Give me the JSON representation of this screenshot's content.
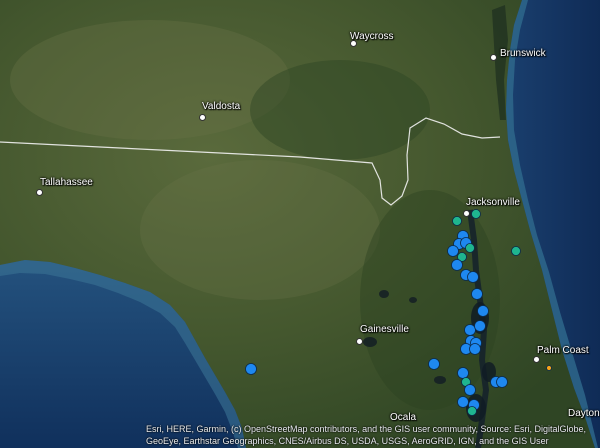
{
  "map": {
    "colors": {
      "land": "#3b4f2a",
      "water": "#15335f",
      "deep_water": "#102a52",
      "border": "#f2f2f2",
      "marker_blue": "#1e88f0",
      "marker_teal": "#1fb58f",
      "marker_orange": "#f5a31a"
    },
    "cities": [
      {
        "name": "Waycross"
      },
      {
        "name": "Brunswick"
      },
      {
        "name": "Valdosta"
      },
      {
        "name": "Tallahassee"
      },
      {
        "name": "Jacksonville"
      },
      {
        "name": "Gainesville"
      },
      {
        "name": "Palm Coast"
      },
      {
        "name": "Ocala"
      },
      {
        "name": "Dayton"
      }
    ],
    "attribution": "Esri, HERE, Garmin, (c) OpenStreetMap contributors, and the GIS user community, Source: Esri, DigitalGlobe, GeoEye, Earthstar Geographics, CNES/Airbus DS, USDA, USGS, AeroGRID, IGN, and the GIS User Community"
  }
}
